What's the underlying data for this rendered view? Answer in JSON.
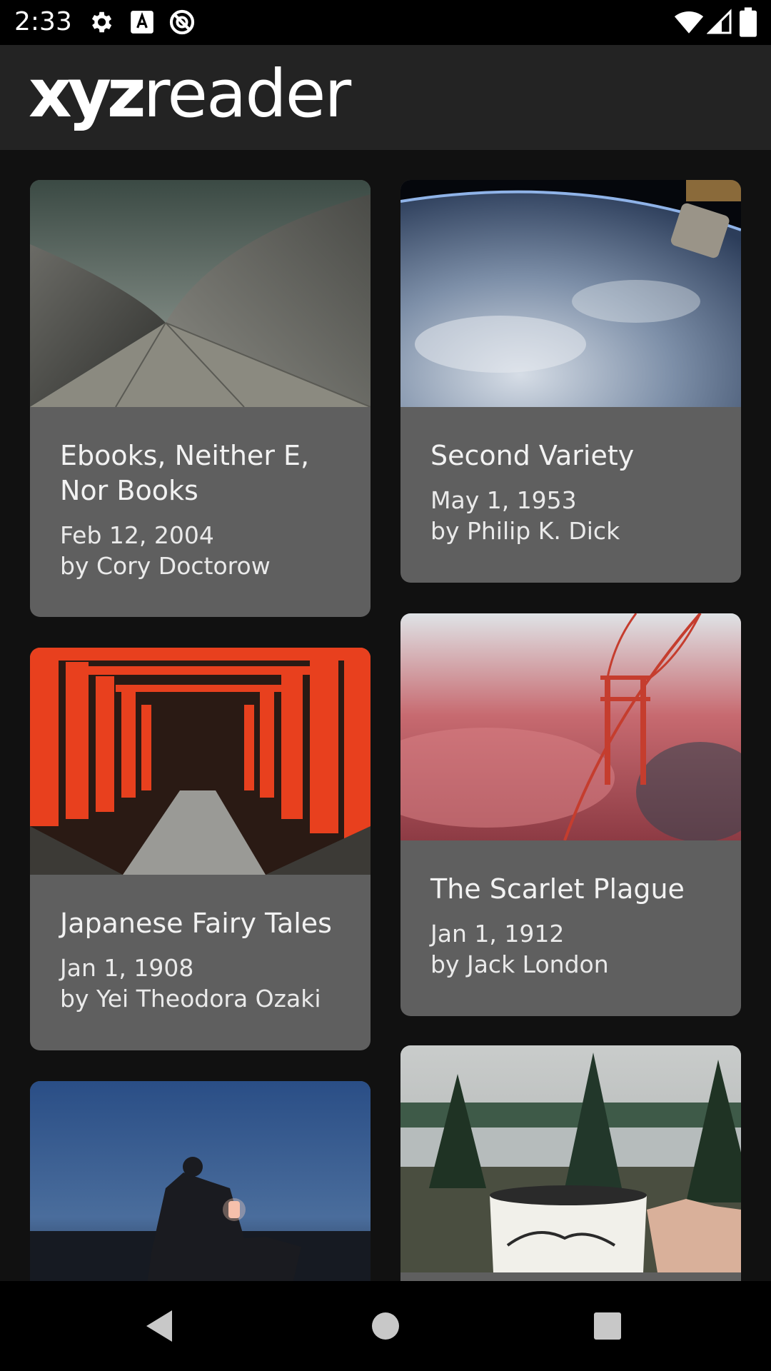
{
  "status_bar": {
    "time": "2:33",
    "icons": [
      "gear-icon",
      "font-a-icon",
      "no-disturb-icon",
      "wifi-icon",
      "signal-icon",
      "battery-icon"
    ]
  },
  "app_bar": {
    "logo_bold": "xyz",
    "logo_light": "reader"
  },
  "articles": [
    {
      "title": "Ebooks, Neither E, Nor Books",
      "date": "Feb 12, 2004",
      "author": "by Cory Doctorow",
      "image": "opera-house-roof"
    },
    {
      "title": "Second Variety",
      "date": "May 1, 1953",
      "author": "by Philip K. Dick",
      "image": "earth-from-space"
    },
    {
      "title": "Japanese Fairy Tales",
      "date": "Jan 1, 1908",
      "author": "by Yei Theodora Ozaki",
      "image": "torii-gates"
    },
    {
      "title": "The Scarlet Plague",
      "date": "Jan 1, 1912",
      "author": "by Jack London",
      "image": "bridge-in-fog"
    },
    {
      "title": "",
      "date": "",
      "author": "",
      "image": "lantern-night"
    },
    {
      "title": "",
      "date": "",
      "author": "",
      "image": "lake-mug"
    }
  ],
  "nav_bar": {
    "buttons": [
      "back-icon",
      "home-icon",
      "recents-icon"
    ]
  },
  "colors": {
    "background": "#111111",
    "app_bar": "#232323",
    "card": "#5f5f5f",
    "text": "#f2f2f2"
  }
}
